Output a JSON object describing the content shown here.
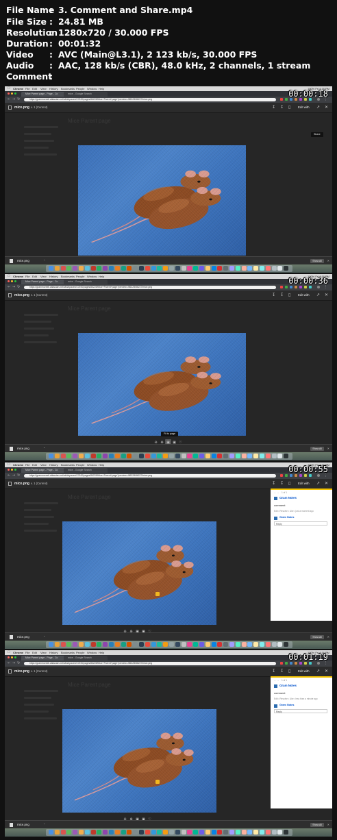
{
  "info": [
    {
      "key": "File Name",
      "value": "3. Comment and Share.mp4"
    },
    {
      "key": "File Size",
      "value": "24.81 MB"
    },
    {
      "key": "Resolution",
      "value": "1280x720 / 30.000 FPS"
    },
    {
      "key": "Duration",
      "value": "00:01:32"
    },
    {
      "key": "Video",
      "value": "AVC (Main@L3.1), 2 123 kb/s, 30.000 FPS"
    },
    {
      "key": "Audio",
      "value": "AAC, 128 kb/s (CBR), 48.0 kHz, 2 channels, 1 stream"
    },
    {
      "key": "Comment",
      "value": ""
    }
  ],
  "colon": ":",
  "menubar": {
    "items": [
      "Chrome",
      "File",
      "Edit",
      "View",
      "History",
      "Bookmarks",
      "People",
      "Window",
      "Help"
    ],
    "status": "100% Fri 4:16 PM"
  },
  "tabs": {
    "active": "Mice Parent page - Page - Co",
    "inactive": "mice - Google Search"
  },
  "address": "https://grammoreeli.atlassian.net/wiki/spaces/CONS/pages/86228/Mice+Parent+page?preview=/86228/86227/mice.png",
  "preview": {
    "filename": "mice.png",
    "version": "v. 1 (Current)",
    "edit_with": "Edit with",
    "page_title_ghost": "Mice Parent page"
  },
  "downloads": {
    "filename": "mice.png",
    "show_all": "Show All"
  },
  "frames": [
    {
      "timestamp": "00:00:18",
      "tooltip": "Share",
      "status_url": "https://grammoreeli.atlassian.net/wiki/spaces/CONS/pages/86228/Mice+Parent+page?preview=/86228/..."
    },
    {
      "timestamp": "00:00:36",
      "tooltip": "Fit to page"
    },
    {
      "timestamp": "00:00:55"
    },
    {
      "timestamp": "00:01:19"
    }
  ],
  "comments": [
    {
      "counter": "1 of 1",
      "author": "Gram Notes",
      "text": "comment",
      "actions": "Edit • Resolve • Like • just a moment ago",
      "reply_author": "Gram Notes",
      "reply_placeholder": "Reply"
    },
    {
      "counter": "1 of 1",
      "author": "Gram Notes",
      "text": "comment",
      "actions": "Edit • Resolve • Like • less than a minute ago",
      "reply_author": "Gram Notes",
      "reply_placeholder": "Reply"
    }
  ],
  "icons": {
    "back": "back-arrow-icon",
    "forward": "forward-arrow-icon",
    "reload": "reload-icon",
    "download": "download-icon",
    "share": "share-icon",
    "close": "close-icon",
    "zoom_in": "zoom-in-icon",
    "zoom_out": "zoom-out-icon",
    "fit": "fit-to-page-icon",
    "comment": "comment-icon"
  }
}
